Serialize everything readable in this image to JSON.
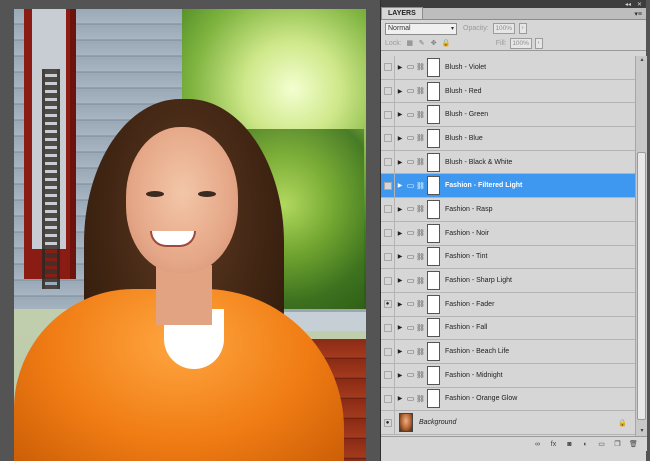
{
  "panel": {
    "tab_label": "LAYERS",
    "blend_mode": "Normal",
    "opacity_label": "Opacity:",
    "opacity_value": "100%",
    "lock_label": "Lock:",
    "fill_label": "Fill:",
    "fill_value": "100%"
  },
  "layers": [
    {
      "name": "Blush - Violet",
      "visible": false,
      "selected": false
    },
    {
      "name": "Blush - Red",
      "visible": false,
      "selected": false
    },
    {
      "name": "Blush - Green",
      "visible": false,
      "selected": false
    },
    {
      "name": "Blush - Blue",
      "visible": false,
      "selected": false
    },
    {
      "name": "Blush - Black & White",
      "visible": false,
      "selected": false
    },
    {
      "name": "Fashion - Filtered Light",
      "visible": false,
      "selected": true
    },
    {
      "name": "Fashion - Rasp",
      "visible": false,
      "selected": false
    },
    {
      "name": "Fashion - Noir",
      "visible": false,
      "selected": false
    },
    {
      "name": "Fashion - Tint",
      "visible": false,
      "selected": false
    },
    {
      "name": "Fashion - Sharp Light",
      "visible": false,
      "selected": false
    },
    {
      "name": "Fashion - Fader",
      "visible": true,
      "selected": false
    },
    {
      "name": "Fashion - Fall",
      "visible": false,
      "selected": false
    },
    {
      "name": "Fashion - Beach Life",
      "visible": false,
      "selected": false
    },
    {
      "name": "Fashion - Midnight",
      "visible": false,
      "selected": false
    },
    {
      "name": "Fashion - Orange Glow",
      "visible": false,
      "selected": false
    }
  ],
  "background_layer": {
    "name": "Background",
    "visible": true
  },
  "colors": {
    "selected": "#3f98ef",
    "panel": "#d6d6d6"
  }
}
